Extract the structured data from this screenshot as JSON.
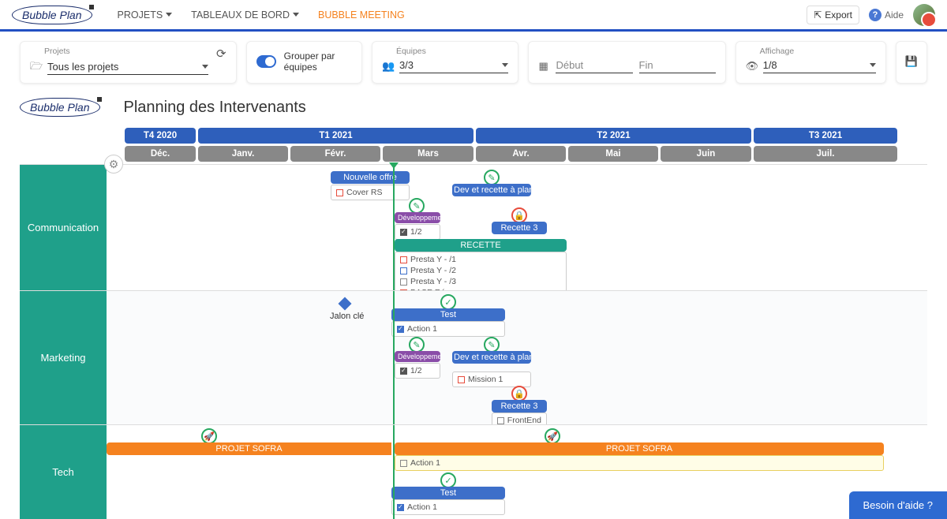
{
  "app_name": "Bubble Plan",
  "nav": {
    "projects": "PROJETS",
    "dashboards": "TABLEAUX DE BORD",
    "meeting": "BUBBLE MEETING",
    "export": "Export",
    "help": "Aide"
  },
  "filters": {
    "projects_label": "Projets",
    "projects_value": "Tous les projets",
    "group_label": "Grouper par équipes",
    "teams_label": "Équipes",
    "teams_value": "3/3",
    "date_start_placeholder": "Début",
    "date_end_placeholder": "Fin",
    "view_label": "Affichage",
    "view_value": "1/8"
  },
  "gantt": {
    "title": "Planning des Intervenants",
    "quarters": [
      "T4 2020",
      "T1 2021",
      "T2 2021",
      "T3 2021"
    ],
    "months": [
      "Déc.",
      "Janv.",
      "Févr.",
      "Mars",
      "Avr.",
      "Mai",
      "Juin",
      "Juil."
    ],
    "lanes": {
      "communication": {
        "label": "Communication",
        "bars": {
          "nouvelle_offre": "Nouvelle offre",
          "cover_rs": "Cover RS",
          "dev_recette": "Dev et recette à planifier",
          "developpement": "Développement",
          "dev_count": "1/2",
          "recette3": "Recette 3",
          "recette": "RECETTE",
          "presta1": "Presta Y - /1",
          "presta2": "Presta Y - /2",
          "presta3": "Presta Y - /3",
          "base_reseau": "BASE Réseau"
        }
      },
      "marketing": {
        "label": "Marketing",
        "milestone": "Jalon clé",
        "bars": {
          "test": "Test",
          "action1": "Action 1",
          "developpement": "Développement",
          "dev_count": "1/2",
          "dev_recette": "Dev et recette à planifier",
          "mission1": "Mission 1",
          "recette3": "Recette 3",
          "frontend": "FrontEnd"
        }
      },
      "tech": {
        "label": "Tech",
        "bars": {
          "projet_sofra": "PROJET SOFRA",
          "action1": "Action 1",
          "test": "Test",
          "action1b": "Action 1"
        }
      }
    }
  },
  "help_float": "Besoin d'aide ?",
  "colors": {
    "brand_blue": "#2e5fbb",
    "teal": "#1fa08a",
    "orange": "#f5821f",
    "purple": "#8a4da8",
    "green": "#27a860",
    "red": "#e74c3c"
  }
}
